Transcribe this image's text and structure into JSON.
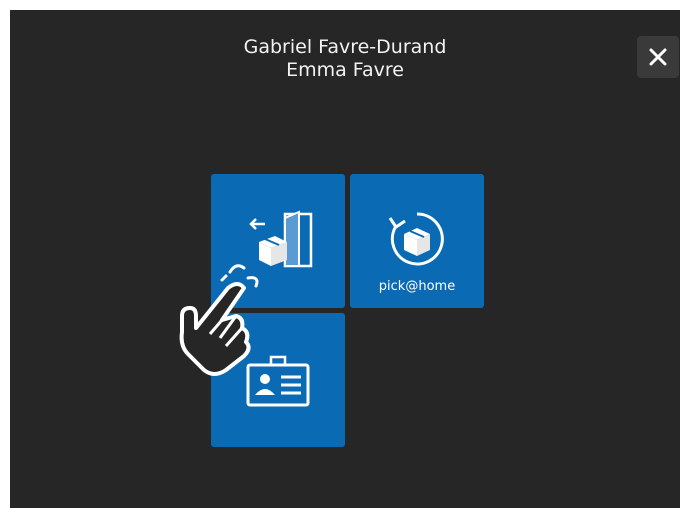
{
  "header": {
    "line1": "Gabriel Favre-Durand",
    "line2": "Emma Favre"
  },
  "close_button": {
    "icon": "close-icon",
    "color": "#ffffff"
  },
  "tiles": [
    {
      "id": "return-parcel",
      "icon": "door-parcel-out-icon",
      "label": ""
    },
    {
      "id": "pick-at-home",
      "icon": "parcel-return-circle-icon",
      "label": "pick@home"
    },
    {
      "id": "id-card",
      "icon": "id-card-icon",
      "label": ""
    }
  ],
  "colors": {
    "background": "#262626",
    "tile": "#0a6ab4",
    "text": "#f2f2f2"
  },
  "overlay": {
    "icon": "tap-hand-icon"
  }
}
